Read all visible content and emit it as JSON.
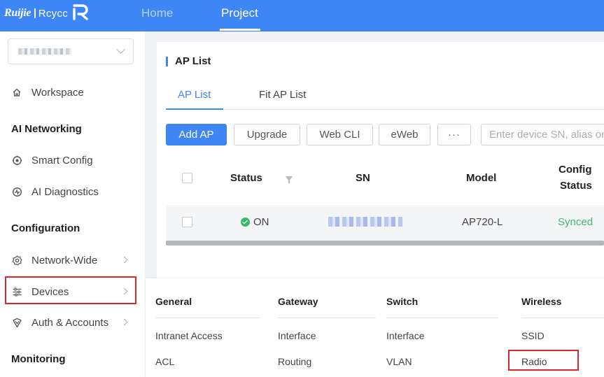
{
  "topbar": {
    "logo_brand": "Ruijie",
    "logo_product": "Rcycc",
    "nav": [
      {
        "label": "Home",
        "active": false
      },
      {
        "label": "Project",
        "active": true
      }
    ],
    "color": "#3e86f5"
  },
  "sidebar": {
    "project_selector": {
      "value": "",
      "icon": "chevron-down-icon"
    },
    "items": [
      {
        "type": "item",
        "label": "Workspace",
        "icon": "home-icon"
      },
      {
        "type": "heading",
        "label": "AI Networking"
      },
      {
        "type": "item",
        "label": "Smart Config",
        "icon": "smart-config-icon"
      },
      {
        "type": "item",
        "label": "AI Diagnostics",
        "icon": "diagnostics-icon"
      },
      {
        "type": "heading",
        "label": "Configuration"
      },
      {
        "type": "item",
        "label": "Network-Wide",
        "icon": "settings-icon",
        "has_arrow": true
      },
      {
        "type": "item",
        "label": "Devices",
        "icon": "sliders-icon",
        "has_arrow": true,
        "highlighted": true
      },
      {
        "type": "item",
        "label": "Auth & Accounts",
        "icon": "shield-heart-icon",
        "has_arrow": true
      },
      {
        "type": "heading",
        "label": "Monitoring"
      }
    ]
  },
  "main": {
    "title": "AP List",
    "tabs": [
      {
        "label": "AP List",
        "active": true
      },
      {
        "label": "Fit AP List",
        "active": false
      }
    ],
    "toolbar": {
      "add": "Add AP",
      "upgrade": "Upgrade",
      "webcli": "Web CLI",
      "eweb": "eWeb",
      "more": "···",
      "search_placeholder": "Enter device SN, alias or"
    },
    "table": {
      "headers": {
        "status": "Status",
        "sn": "SN",
        "model": "Model",
        "config_status_1": "Config",
        "config_status_2": "Status"
      },
      "rows": [
        {
          "status": "ON",
          "sn": "",
          "model": "AP720-L",
          "config_status": "Synced"
        }
      ]
    }
  },
  "dropdown": {
    "columns": [
      {
        "heading": "General",
        "items": [
          "Intranet Access",
          "ACL"
        ]
      },
      {
        "heading": "Gateway",
        "items": [
          "Interface",
          "Routing"
        ]
      },
      {
        "heading": "Switch",
        "items": [
          "Interface",
          "VLAN"
        ]
      },
      {
        "heading": "Wireless",
        "items": [
          "SSID",
          "Radio"
        ],
        "highlighted_item": "Radio"
      }
    ]
  },
  "colors": {
    "accent": "#3e86f5",
    "online": "#3db86b",
    "synced": "#3db86b",
    "highlight_box": "#d8262f"
  }
}
